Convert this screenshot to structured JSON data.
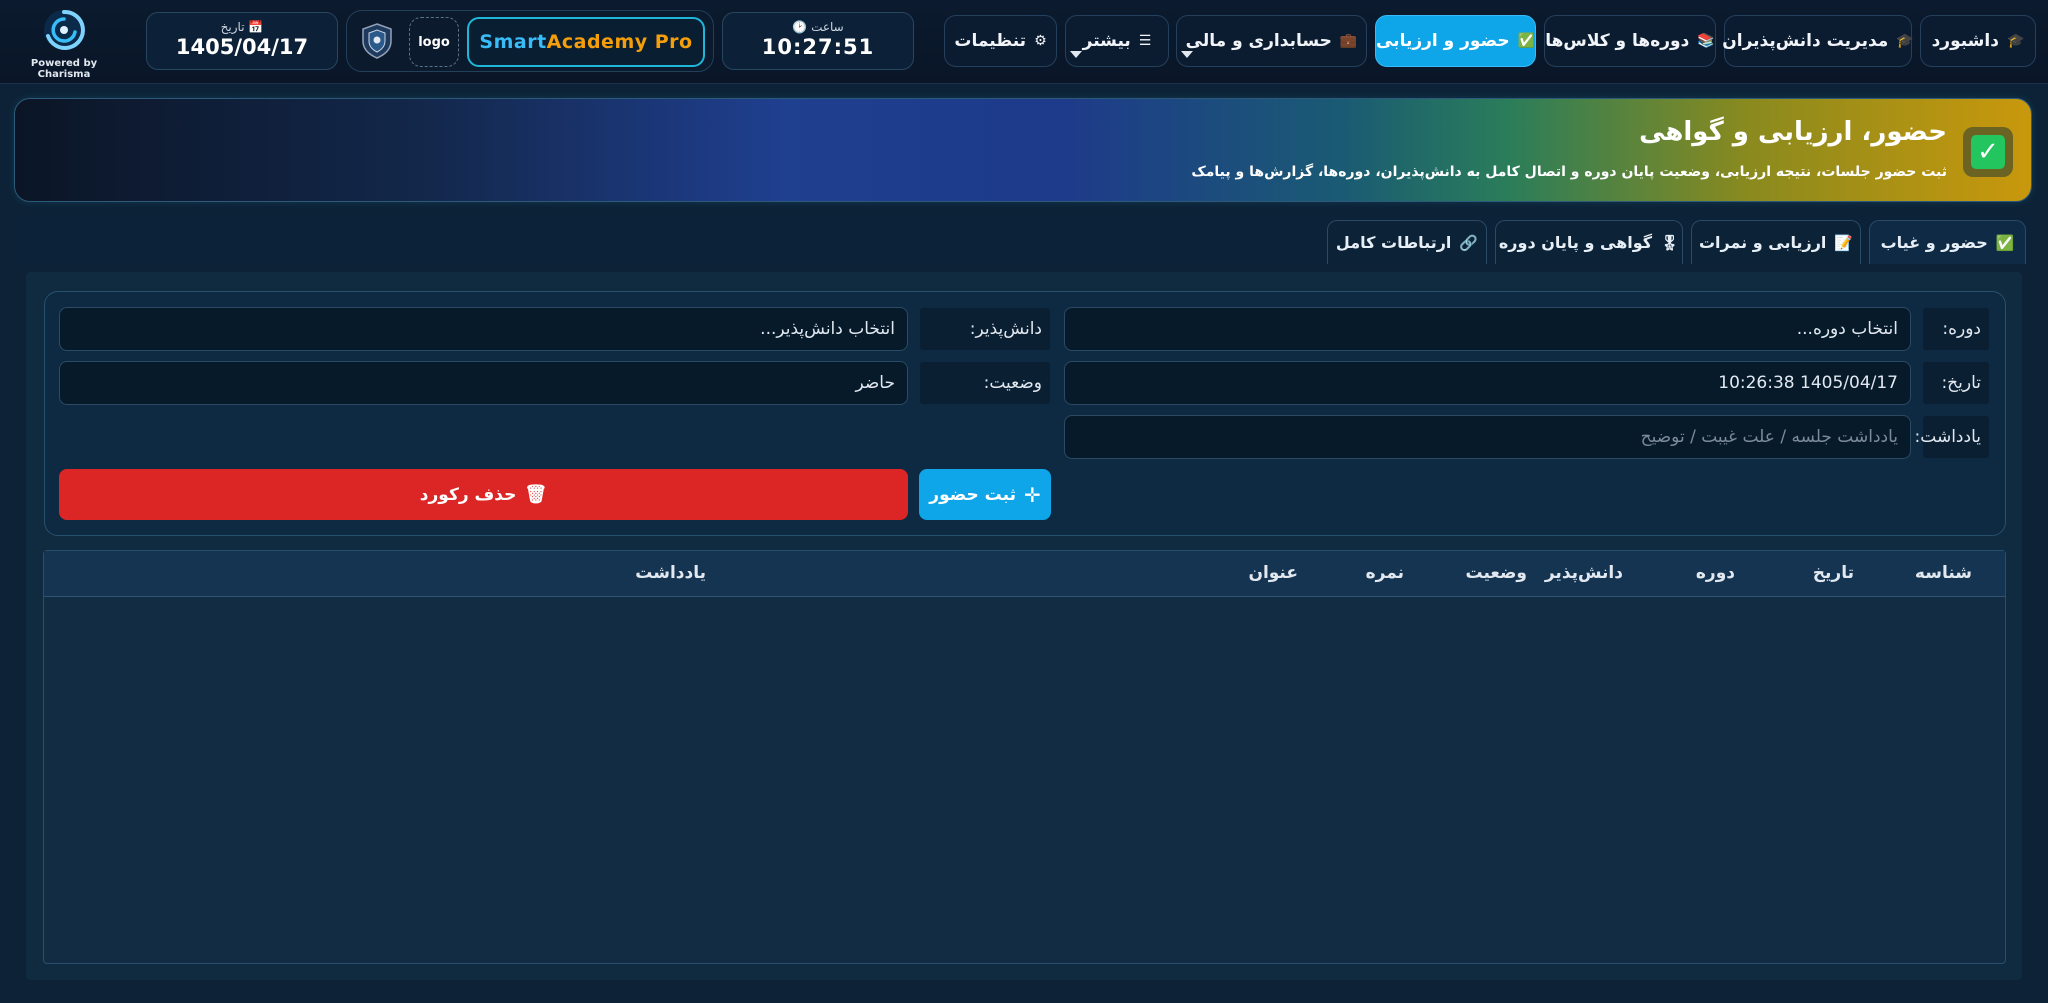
{
  "nav": {
    "dashboard": {
      "label": "داشبورد",
      "icon": "🎓"
    },
    "students": {
      "label": "مدیریت دانش‌پذیران",
      "icon": "🎓"
    },
    "courses": {
      "label": "دوره‌ها و کلاس‌ها",
      "icon": "📚"
    },
    "attendance": {
      "label": "حضور و ارزیابی",
      "icon": "✅"
    },
    "accounting": {
      "label": "حسابداری و مالی",
      "icon": "💼"
    },
    "more": {
      "label": "بیشتر",
      "icon": "☰"
    },
    "settings": {
      "label": "تنظیمات",
      "icon": "⚙"
    }
  },
  "clock": {
    "label": "ساعت",
    "value": "10:27:51"
  },
  "brand": {
    "part1": "Smart ",
    "part2": "Academy Pro",
    "logo_text": "logo"
  },
  "date": {
    "label": "تاریخ",
    "value": "1405/04/17"
  },
  "powered_by": "Powered by Charisma",
  "hero": {
    "title": "حضور، ارزیابی و گواهی",
    "subtitle": "ثبت حضور جلسات، نتیجه ارزیابی، وضعیت پایان دوره و اتصال کامل به دانش‌پذیران، دوره‌ها، گزارش‌ها و پیامک"
  },
  "tabs": [
    {
      "label": "حضور و غیاب",
      "icon": "✅"
    },
    {
      "label": "ارزیابی و نمرات",
      "icon": "📝"
    },
    {
      "label": "گواهی و پایان دوره",
      "icon": "🎖"
    },
    {
      "label": "ارتباطات کامل",
      "icon": "🔗"
    }
  ],
  "form": {
    "course_label": "دوره:",
    "course_value": "انتخاب دوره...",
    "student_label": "دانش‌پذیر:",
    "student_value": "انتخاب دانش‌پذیر...",
    "date_label": "تاریخ:",
    "date_value": "1405/04/17  10:26:38",
    "status_label": "وضعیت:",
    "status_value": "حاضر",
    "note_label": "یادداشت:",
    "note_placeholder": "یادداشت جلسه / علت غیبت / توضیح",
    "submit_label": "ثبت حضور",
    "delete_label": "حذف رکورد"
  },
  "table": {
    "columns": [
      "شناسه",
      "تاریخ",
      "دوره",
      "دانش‌پذیر",
      "وضعیت",
      "نمره",
      "عنوان",
      "یادداشت"
    ],
    "rows": []
  },
  "colors": {
    "accent": "#0ea5e9",
    "danger": "#dc2626",
    "success": "#22c55e",
    "background": "#0d2236"
  }
}
